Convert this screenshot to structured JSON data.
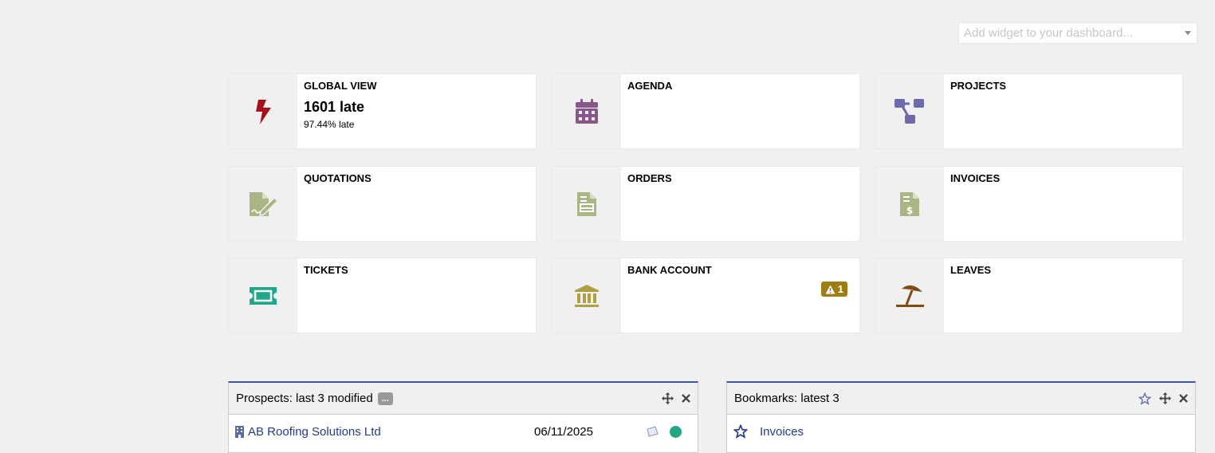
{
  "widget_selector": {
    "placeholder": "Add widget to your dashboard..."
  },
  "boxes": [
    {
      "title": "GLOBAL VIEW",
      "big": "1601 late",
      "small": "97.44% late",
      "icon": "bolt-icon",
      "color": "#a7101b"
    },
    {
      "title": "AGENDA",
      "icon": "calendar-icon",
      "color": "#88578a"
    },
    {
      "title": "PROJECTS",
      "icon": "project-network-icon",
      "color": "#6c6aa8"
    },
    {
      "title": "QUOTATIONS",
      "icon": "signed-document-icon",
      "color": "#a8b683"
    },
    {
      "title": "ORDERS",
      "icon": "order-document-icon",
      "color": "#a8b683"
    },
    {
      "title": "INVOICES",
      "icon": "invoice-document-icon",
      "color": "#a8b683"
    },
    {
      "title": "TICKETS",
      "icon": "ticket-icon",
      "color": "#20a68a"
    },
    {
      "title": "BANK ACCOUNT",
      "icon": "bank-icon",
      "color": "#b0a045",
      "badge": "1",
      "badge_color": "#9c7d11"
    },
    {
      "title": "LEAVES",
      "icon": "umbrella-beach-icon",
      "color": "#7e4b15"
    }
  ],
  "prospects_panel": {
    "title": "Prospects: last 3 modified",
    "more_label": "...",
    "rows": [
      {
        "name": "AB Roofing Solutions Ltd",
        "date": "06/11/2025",
        "status_color": "#25a580"
      }
    ]
  },
  "bookmarks_panel": {
    "title": "Bookmarks: latest 3",
    "rows": [
      {
        "label": "Invoices"
      }
    ]
  }
}
